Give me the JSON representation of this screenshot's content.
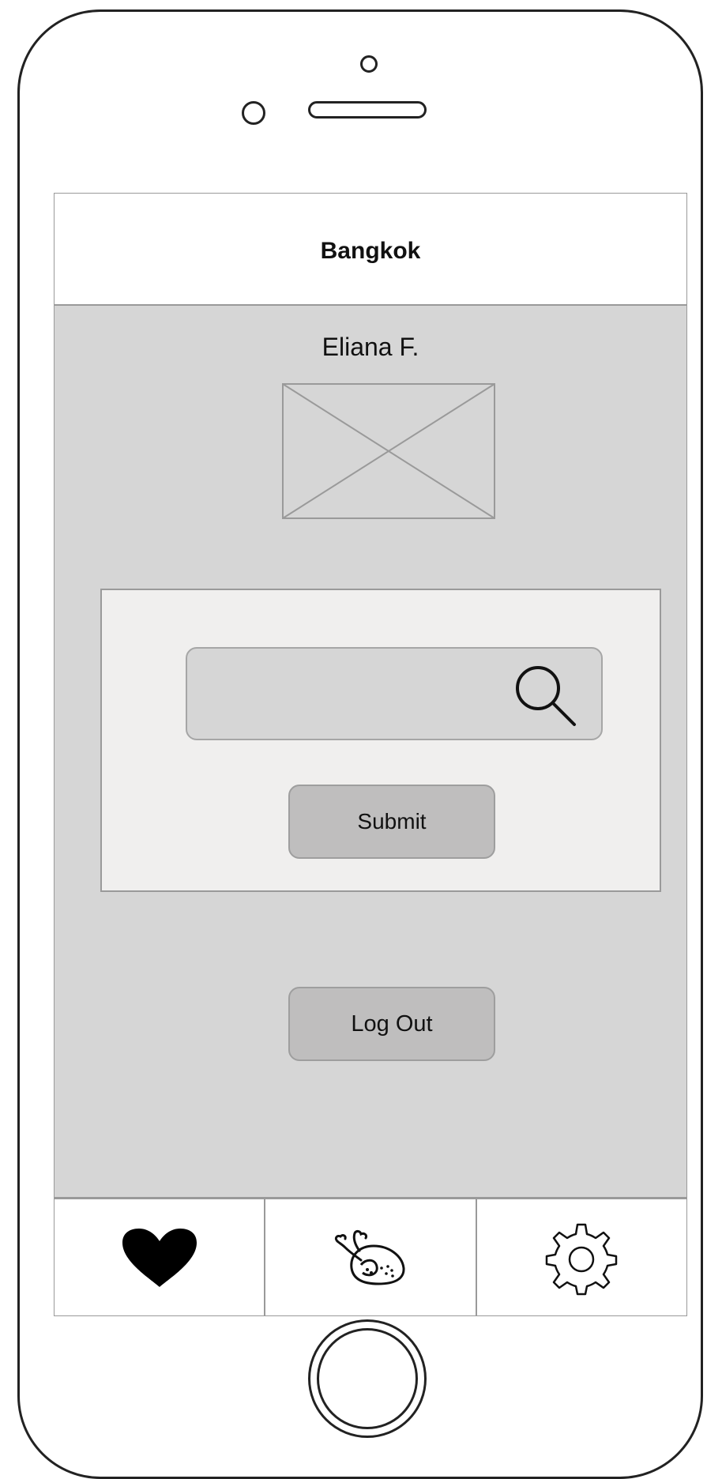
{
  "header": {
    "title": "Bangkok"
  },
  "profile": {
    "name": "Eliana F.",
    "image": "image-placeholder"
  },
  "search": {
    "value": "",
    "placeholder": "",
    "icon": "search-icon"
  },
  "form": {
    "submit_label": "Submit"
  },
  "account": {
    "logout_label": "Log Out"
  },
  "tab_bar": {
    "tabs": [
      {
        "icon": "heart-icon"
      },
      {
        "icon": "roast-chicken-icon"
      },
      {
        "icon": "gear-icon"
      }
    ]
  },
  "device": {
    "controls": [
      "camera-dot",
      "front-sensor",
      "speaker-slot",
      "home-button"
    ]
  }
}
